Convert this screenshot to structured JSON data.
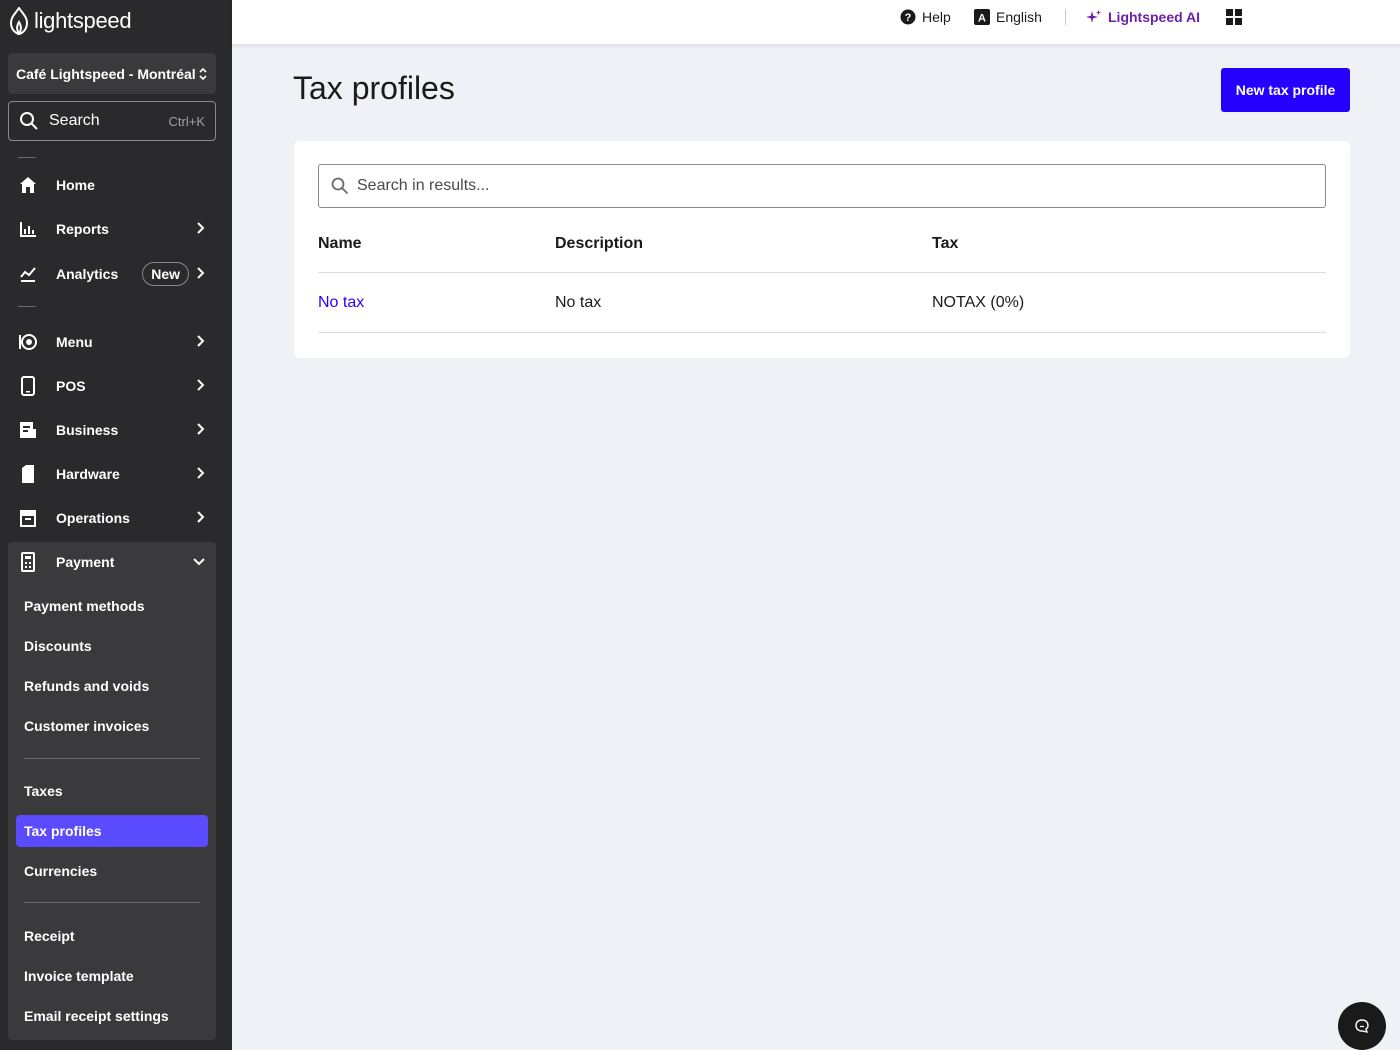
{
  "brand": {
    "name": "lightspeed"
  },
  "store": {
    "name": "Café Lightspeed - Montréal"
  },
  "sidebar_search": {
    "label": "Search",
    "shortcut": "Ctrl+K"
  },
  "nav": {
    "home": "Home",
    "reports": "Reports",
    "analytics": "Analytics",
    "analytics_badge": "New",
    "menu": "Menu",
    "pos": "POS",
    "business": "Business",
    "hardware": "Hardware",
    "operations": "Operations",
    "payment": "Payment"
  },
  "payment_submenu": {
    "payment_methods": "Payment methods",
    "discounts": "Discounts",
    "refunds_voids": "Refunds and voids",
    "customer_invoices": "Customer invoices",
    "taxes": "Taxes",
    "tax_profiles": "Tax profiles",
    "currencies": "Currencies",
    "receipt": "Receipt",
    "invoice_template": "Invoice template",
    "email_receipt_settings": "Email receipt settings"
  },
  "topbar": {
    "help": "Help",
    "language": "English",
    "ai": "Lightspeed AI"
  },
  "page": {
    "title": "Tax profiles",
    "new_button": "New tax profile",
    "search_placeholder": "Search in results..."
  },
  "table": {
    "headers": {
      "name": "Name",
      "description": "Description",
      "tax": "Tax"
    },
    "rows": [
      {
        "name": "No tax",
        "description": "No tax",
        "tax": "NOTAX (0%)"
      }
    ]
  },
  "colors": {
    "sidebar_bg": "#2a2a2c",
    "accent": "#2600ff",
    "active_item": "#5b4bff",
    "ai_purple": "#6b21a8"
  }
}
